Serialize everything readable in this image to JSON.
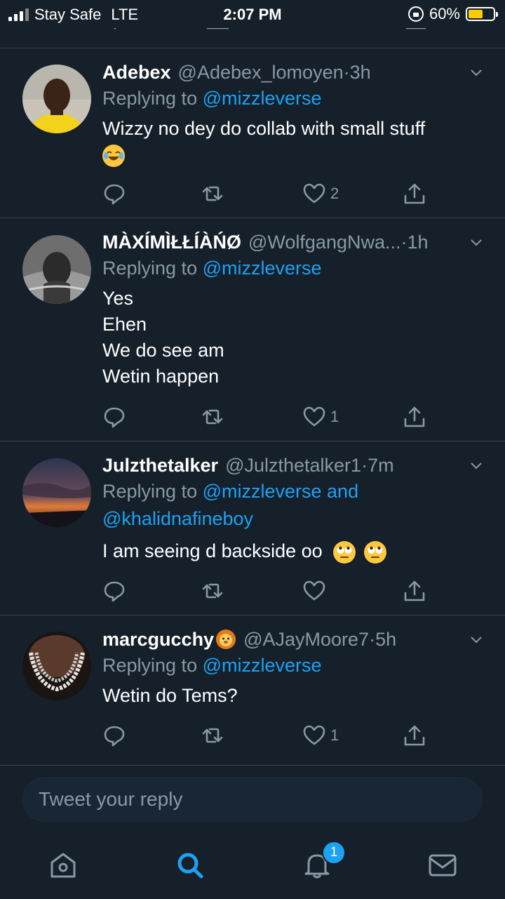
{
  "status": {
    "carrier": "Stay Safe",
    "network": "LTE",
    "time": "2:07 PM",
    "battery": "60%",
    "battery_level": 0.6,
    "battery_color": "#ffcc00"
  },
  "colors": {
    "background": "#15202b",
    "accent": "#1da1f2",
    "muted": "#8899a6",
    "divider": "#38444d"
  },
  "tweets": [
    {
      "name": "Adebex",
      "handle": "@Adebex_lomoyen",
      "dot": " · ",
      "time": "3h",
      "replying_prefix": "Replying to ",
      "replying_to": "@mizzleverse",
      "text": "Wizzy no dey do collab with small stuff",
      "emoji": "face-with-tears-of-joy",
      "likes": "2"
    },
    {
      "name": "MÀXÍMÌŁŁÍÀŃØ",
      "handle": "@WolfgangNwa...",
      "dot": " · ",
      "time": "1h",
      "replying_prefix": "Replying to ",
      "replying_to": "@mizzleverse",
      "lines": [
        "Yes",
        "Ehen",
        "We do see am",
        "Wetin happen"
      ],
      "likes": "1"
    },
    {
      "name": "Julzthetalker",
      "handle": "@Julzthetalker1",
      "dot": " · ",
      "time": "7m",
      "replying_prefix": "Replying to ",
      "replying_to": "@mizzleverse and",
      "replying_to_2": "@khalidnafineboy",
      "text": "I am seeing d backside oo",
      "emoji": "face-with-rolling-eyes",
      "likes": ""
    },
    {
      "name": "marcgucchy",
      "name_emoji": "lion-face",
      "handle": "@AJayMoore7",
      "dot": " · ",
      "time": "5h",
      "replying_prefix": "Replying to ",
      "replying_to": "@mizzleverse",
      "text": "Wetin do Tems?",
      "likes": "1"
    }
  ],
  "composer": {
    "placeholder": "Tweet your reply"
  },
  "tabbar": {
    "notifications_badge": "1",
    "items": [
      "home-icon",
      "search-icon",
      "notifications-icon",
      "messages-icon"
    ]
  }
}
